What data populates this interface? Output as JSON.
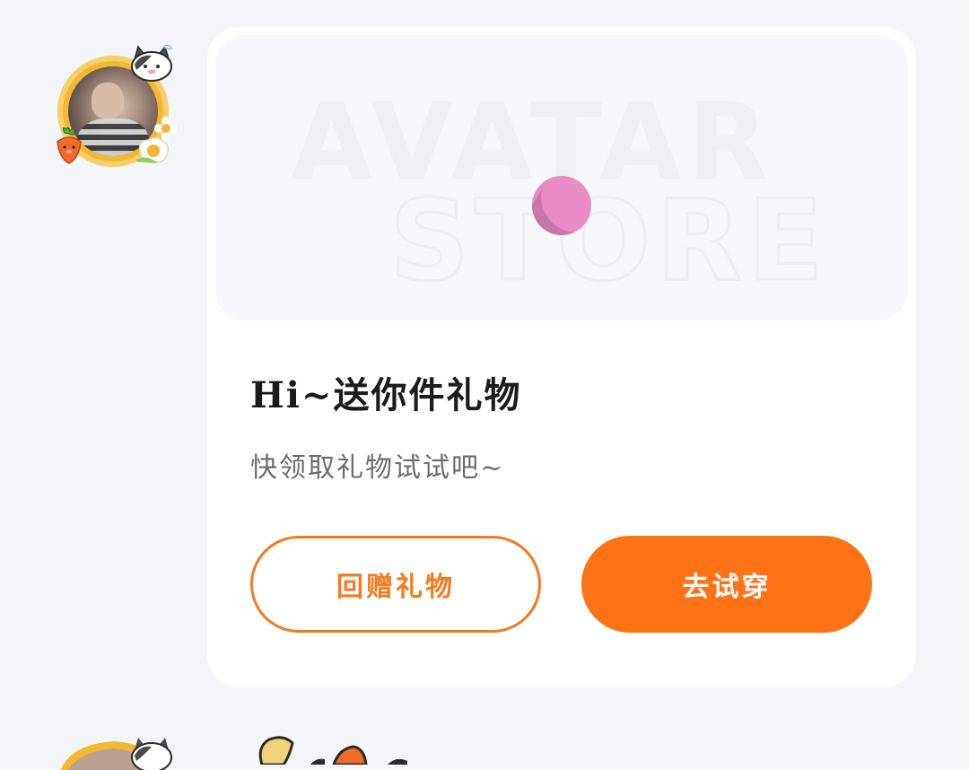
{
  "message": {
    "banner": {
      "watermark_line1": "AVATAR",
      "watermark_line2": "STORE"
    },
    "title": "Hi~送你件礼物",
    "subtitle": "快领取礼物试试吧~",
    "buttons": {
      "gift_back_label": "回赠礼物",
      "try_on_label": "去试穿"
    }
  },
  "colors": {
    "accent": "#ff7316",
    "outline": "#f47a20",
    "page_bg": "#f3f5f9",
    "card_bg": "#ffffff",
    "ball": "#e98cc3"
  },
  "icons": {
    "avatar_decorations": [
      "cat-icon",
      "carrot-icon",
      "fried-egg-icon",
      "flower-icon"
    ]
  }
}
